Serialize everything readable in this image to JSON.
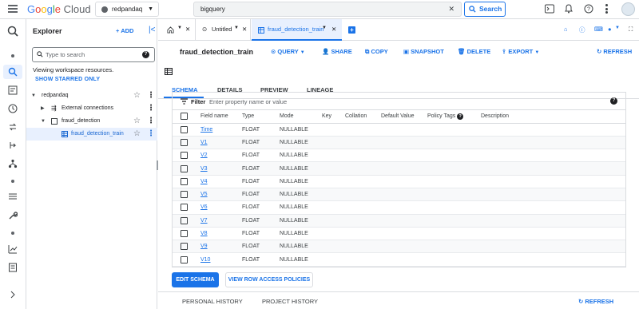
{
  "topbar": {
    "logo": "Google Cloud",
    "project": "redpandaq",
    "search_value": "bigquery",
    "search_button": "Search"
  },
  "explorer": {
    "title": "Explorer",
    "add_label": "ADD",
    "search_placeholder": "Type to search",
    "viewing": "Viewing workspace resources.",
    "show_starred": "SHOW STARRED ONLY",
    "tree": [
      {
        "label": "redpandaq"
      },
      {
        "label": "External connections"
      },
      {
        "label": "fraud_detection"
      },
      {
        "label": "fraud_detection_train"
      }
    ]
  },
  "tabs": [
    {
      "label": "Untitled"
    },
    {
      "label": "fraud_detection_train"
    }
  ],
  "header": {
    "title": "fraud_detection_train",
    "actions": [
      "QUERY",
      "SHARE",
      "COPY",
      "SNAPSHOT",
      "DELETE",
      "EXPORT",
      "REFRESH"
    ]
  },
  "subtabs": [
    "SCHEMA",
    "DETAILS",
    "PREVIEW",
    "LINEAGE"
  ],
  "schema": {
    "filter_label": "Filter",
    "filter_placeholder": "Enter property name or value",
    "columns": [
      "Field name",
      "Type",
      "Mode",
      "Key",
      "Collation",
      "Default Value",
      "Policy Tags",
      "Description"
    ],
    "rows": [
      {
        "name": "Time",
        "type": "FLOAT",
        "mode": "NULLABLE"
      },
      {
        "name": "V1",
        "type": "FLOAT",
        "mode": "NULLABLE"
      },
      {
        "name": "V2",
        "type": "FLOAT",
        "mode": "NULLABLE"
      },
      {
        "name": "V3",
        "type": "FLOAT",
        "mode": "NULLABLE"
      },
      {
        "name": "V4",
        "type": "FLOAT",
        "mode": "NULLABLE"
      },
      {
        "name": "V5",
        "type": "FLOAT",
        "mode": "NULLABLE"
      },
      {
        "name": "V6",
        "type": "FLOAT",
        "mode": "NULLABLE"
      },
      {
        "name": "V7",
        "type": "FLOAT",
        "mode": "NULLABLE"
      },
      {
        "name": "V8",
        "type": "FLOAT",
        "mode": "NULLABLE"
      },
      {
        "name": "V9",
        "type": "FLOAT",
        "mode": "NULLABLE"
      },
      {
        "name": "V10",
        "type": "FLOAT",
        "mode": "NULLABLE"
      }
    ]
  },
  "buttons": {
    "edit_schema": "EDIT SCHEMA",
    "view_row_access": "VIEW ROW ACCESS POLICIES"
  },
  "bottom": {
    "personal_history": "PERSONAL HISTORY",
    "project_history": "PROJECT HISTORY",
    "refresh": "REFRESH"
  }
}
